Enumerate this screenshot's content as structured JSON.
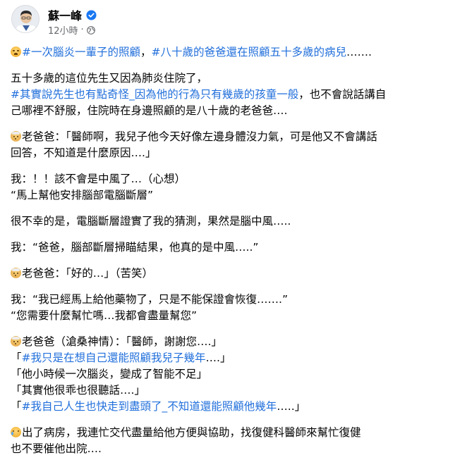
{
  "header": {
    "author_name": "蘇一峰",
    "timestamp": "12小時",
    "separator": "·",
    "verified_icon": "verified-badge-icon",
    "privacy_icon": "globe-icon",
    "colors": {
      "verified": "#1877f2",
      "link": "#216fdb",
      "meta": "#65676b"
    }
  },
  "post": {
    "p1": {
      "emoji": "crying-face-emoji",
      "tag1": "#一次腦炎一輩子的照顧",
      "sep": "，",
      "tag2": "#八十歲的爸爸還在照顧五十多歲的病兒",
      "tail": "……."
    },
    "p2": {
      "line1": "五十多歲的這位先生又因為肺炎住院了，",
      "tag": "#其實說先生也有點奇怪_因為他的行為只有幾歲的孩童一般",
      "line2_tail": "，也不會說話講自",
      "line3": "己哪裡不舒服，住院時在身邊照顧的是八十歲的老爸爸…."
    },
    "p3": {
      "emoji": "old-man-emoji",
      "line1": "老爸爸：「醫師啊，我兒子他今天好像左邊身體沒力氣，可是他又不會講話",
      "line2": "回答，不知道是什麼原因….」"
    },
    "p4": {
      "line1": "我：！！該不會是中風了…（心想）",
      "line2": "“馬上幫他安排腦部電腦斷層”"
    },
    "p5": {
      "line1": "很不幸的是，電腦斷層證實了我的猜測，果然是腦中風….."
    },
    "p6": {
      "line1": "我：“爸爸，腦部斷層掃瞄結果，他真的是中風…..”"
    },
    "p7": {
      "emoji": "old-man-emoji",
      "line1": "老爸爸：「好的…」（苦笑）"
    },
    "p8": {
      "line1": "我：“我已經馬上給他藥物了，只是不能保證會恢復…….”",
      "line2": "“您需要什麼幫忙嗎…我都會盡量幫您”"
    },
    "p9": {
      "emoji": "old-man-emoji",
      "line1": "老爸爸（滄桑神情）：「醫師，謝謝您….」",
      "line2_open": "「",
      "line2_tag": "#我只是在想自己還能照顧我兒子幾年",
      "line2_close": "….」",
      "line3": "「他小時候一次腦炎，變成了智能不足」",
      "line4": "「其實他很乖也很聽話….」",
      "line5_open": "「",
      "line5_tag": "#我自己人生也快走到盡頭了_不知道還能照顧他幾年",
      "line5_close": "…..」"
    },
    "p10": {
      "emoji": "sad-tear-emoji",
      "line1": "出了病房，我連忙交代盡量給他方便與協助，找復健科醫師來幫忙復健",
      "line2": "也不要催他出院…."
    }
  }
}
